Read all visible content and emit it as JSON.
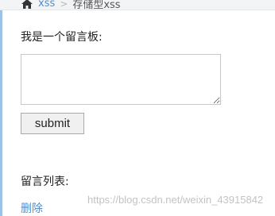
{
  "breadcrumb": {
    "home_icon": "home-icon",
    "section": "xss",
    "separator": ">",
    "current": "存储型xss"
  },
  "board": {
    "label": "我是一个留言板:",
    "textarea_value": "",
    "submit_label": "submit"
  },
  "messages": {
    "label": "留言列表:",
    "delete_label": "删除"
  },
  "watermark": "https://blog.csdn.net/weixin_43915842",
  "colors": {
    "link": "#4a8fd1",
    "text": "#222222",
    "breadcrumb_bg": "#f3f4f6"
  }
}
